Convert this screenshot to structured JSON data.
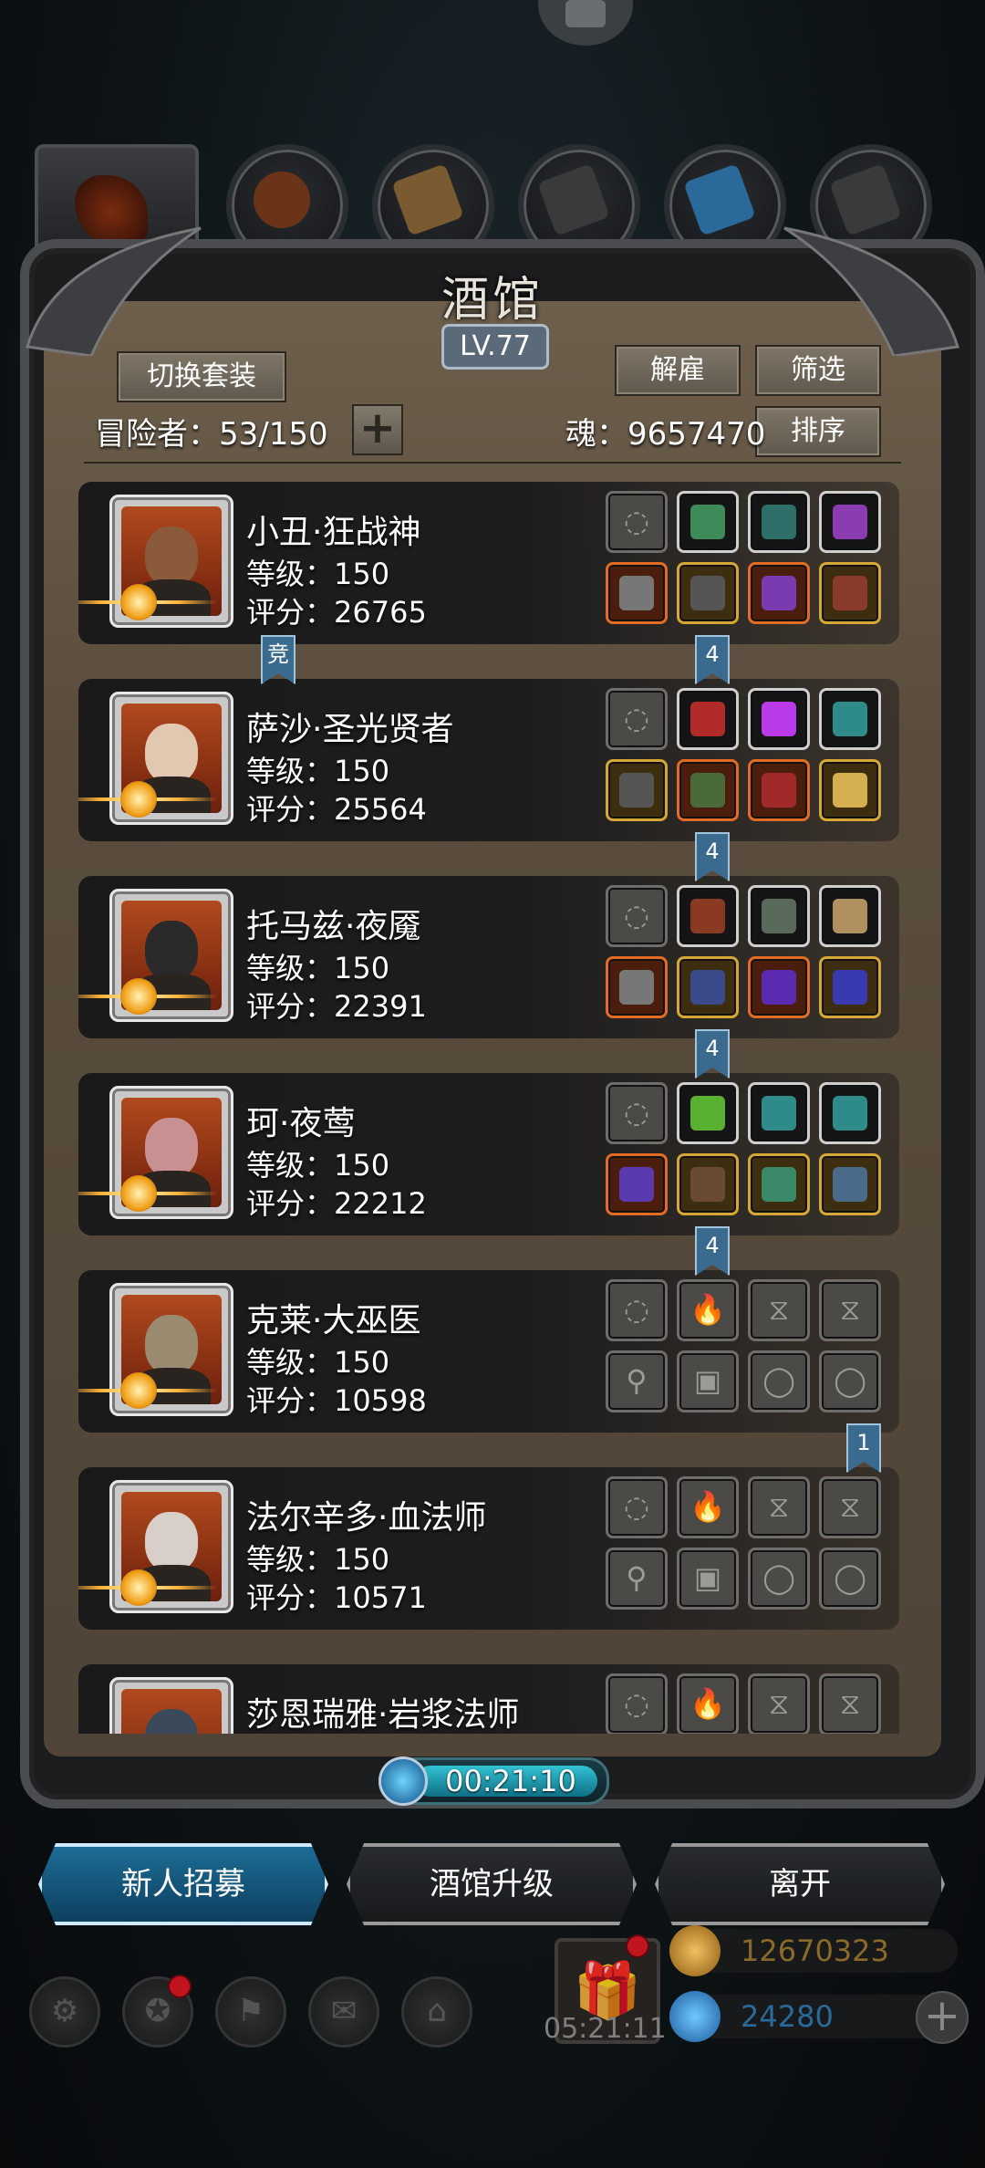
{
  "tavern": {
    "title": "酒馆",
    "level": "LV.77",
    "switch_outfit": "切换套装",
    "dismiss": "解雇",
    "filter": "筛选",
    "sort": "排序",
    "adventurers_label": "冒险者：53/150",
    "souls_label": "魂：9657470",
    "add": "+"
  },
  "category_tabs": [
    "all",
    "armor",
    "cloak",
    "boots",
    "crystal",
    "material"
  ],
  "heroes": [
    {
      "name": "小丑·狂战神",
      "level": "等级：150",
      "score": "评分：26765",
      "portrait_color": "#8a5a3a",
      "slots_top": [
        {
          "t": "empty",
          "i": "necklace-icon"
        },
        {
          "t": "white",
          "i": "emerald-icon",
          "c": "#3d8a5a"
        },
        {
          "t": "white",
          "i": "stone-icon",
          "c": "#2f6f6a"
        },
        {
          "t": "white",
          "i": "lantern-icon",
          "c": "#8a3cb0"
        }
      ],
      "slots_bottom": [
        {
          "t": "orange",
          "i": "axe-icon",
          "c": "#777"
        },
        {
          "t": "gold",
          "i": "armor-icon",
          "c": "#555"
        },
        {
          "t": "orange",
          "i": "helmet-icon",
          "c": "#7a3ab0"
        },
        {
          "t": "gold",
          "i": "bracer-icon",
          "c": "#8a3a2a"
        }
      ]
    },
    {
      "name": "萨沙·圣光贤者",
      "level": "等级：150",
      "score": "评分：25564",
      "portrait_color": "#e2c8b0",
      "slots_top": [
        {
          "t": "empty",
          "i": "necklace-icon"
        },
        {
          "t": "white",
          "i": "rose-icon",
          "c": "#b02a2a"
        },
        {
          "t": "white",
          "i": "amethyst-icon",
          "c": "#b83ae8"
        },
        {
          "t": "white",
          "i": "stone-icon",
          "c": "#2f8a8a"
        }
      ],
      "slots_bottom": [
        {
          "t": "gold",
          "i": "spear-icon",
          "c": "#555"
        },
        {
          "t": "orange",
          "i": "armor-icon",
          "c": "#4a6a3a"
        },
        {
          "t": "orange",
          "i": "helmet-icon",
          "c": "#a02a2a"
        },
        {
          "t": "gold",
          "i": "shield-icon",
          "c": "#d4b050"
        }
      ]
    },
    {
      "name": "托马兹·夜魇",
      "level": "等级：150",
      "score": "评分：22391",
      "portrait_color": "#2a2a2a",
      "slots_top": [
        {
          "t": "empty",
          "i": "necklace-icon"
        },
        {
          "t": "white",
          "i": "meat-icon",
          "c": "#8a3a20"
        },
        {
          "t": "white",
          "i": "rabbit-icon",
          "c": "#5a6a5a"
        },
        {
          "t": "white",
          "i": "book-icon",
          "c": "#b09060"
        }
      ],
      "slots_bottom": [
        {
          "t": "orange",
          "i": "spear-icon",
          "c": "#777"
        },
        {
          "t": "gold",
          "i": "armor-icon",
          "c": "#3a4a8a"
        },
        {
          "t": "orange",
          "i": "helmet-icon",
          "c": "#5a2ab0"
        },
        {
          "t": "gold",
          "i": "ring-icon",
          "c": "#3a3ab0"
        }
      ]
    },
    {
      "name": "珂·夜莺",
      "level": "等级：150",
      "score": "评分：22212",
      "portrait_color": "#c89090",
      "slots_top": [
        {
          "t": "empty",
          "i": "necklace-icon"
        },
        {
          "t": "white",
          "i": "potion-icon",
          "c": "#5ab030"
        },
        {
          "t": "white",
          "i": "stone-icon",
          "c": "#2f8a8a"
        },
        {
          "t": "white",
          "i": "stone-icon",
          "c": "#2f8a8a"
        }
      ],
      "slots_bottom": [
        {
          "t": "orange",
          "i": "dagger-icon",
          "c": "#5a3ab0"
        },
        {
          "t": "gold",
          "i": "armor-icon",
          "c": "#6a4a30"
        },
        {
          "t": "gold",
          "i": "bracer-icon",
          "c": "#3a8a6a"
        },
        {
          "t": "gold",
          "i": "amulet-icon",
          "c": "#4a6a8a"
        }
      ]
    },
    {
      "name": "克莱·大巫医",
      "level": "等级：150",
      "score": "评分：10598",
      "portrait_color": "#9a8a70",
      "slots_top": [
        {
          "t": "empty",
          "i": "necklace-icon"
        },
        {
          "t": "empty",
          "i": "flame-icon",
          "g": "🔥"
        },
        {
          "t": "empty",
          "i": "hourglass-icon",
          "g": "⧖"
        },
        {
          "t": "empty",
          "i": "hourglass-icon",
          "g": "⧖"
        }
      ],
      "slots_bottom": [
        {
          "t": "empty",
          "i": "staff-icon",
          "g": "⚲"
        },
        {
          "t": "empty",
          "i": "armor-icon",
          "g": "▣"
        },
        {
          "t": "empty",
          "i": "ring-icon",
          "g": "◯"
        },
        {
          "t": "empty",
          "i": "ring-icon",
          "g": "◯"
        }
      ]
    },
    {
      "name": "法尔辛多·血法师",
      "level": "等级：150",
      "score": "评分：10571",
      "portrait_color": "#d8cfc8",
      "slots_top": [
        {
          "t": "empty",
          "i": "necklace-icon"
        },
        {
          "t": "empty",
          "i": "flame-icon",
          "g": "🔥"
        },
        {
          "t": "empty",
          "i": "hourglass-icon",
          "g": "⧖"
        },
        {
          "t": "empty",
          "i": "hourglass-icon",
          "g": "⧖"
        }
      ],
      "slots_bottom": [
        {
          "t": "empty",
          "i": "staff-icon",
          "g": "⚲"
        },
        {
          "t": "empty",
          "i": "armor-icon",
          "g": "▣"
        },
        {
          "t": "empty",
          "i": "ring-icon",
          "g": "◯"
        },
        {
          "t": "empty",
          "i": "ring-icon",
          "g": "◯"
        }
      ]
    },
    {
      "name": "莎恩瑞雅·岩浆法师",
      "level": "",
      "score": "",
      "portrait_color": "#3a4a5a",
      "slots_top": [
        {
          "t": "empty",
          "i": "necklace-icon"
        },
        {
          "t": "empty",
          "i": "flame-icon",
          "g": "🔥"
        },
        {
          "t": "empty",
          "i": "hourglass-icon",
          "g": "⧖"
        },
        {
          "t": "empty",
          "i": "hourglass-icon",
          "g": "⧖"
        }
      ],
      "slots_bottom": []
    }
  ],
  "ribbons": [
    {
      "text": "竞",
      "row": 0,
      "pos": "left"
    },
    {
      "text": "4",
      "row": 0,
      "pos": "right"
    },
    {
      "text": "4",
      "row": 1,
      "pos": "right"
    },
    {
      "text": "4",
      "row": 2,
      "pos": "right"
    },
    {
      "text": "4",
      "row": 3,
      "pos": "right"
    },
    {
      "text": "1",
      "row": 4,
      "pos": "far-right"
    }
  ],
  "timer": "00:21:10",
  "buttons": {
    "recruit": "新人招募",
    "upgrade": "酒馆升级",
    "leave": "离开"
  },
  "tray": {
    "gift_timer": "05:21:11"
  },
  "resources": {
    "gold": "12670323",
    "gems": "24280",
    "add": "+"
  },
  "colors": {
    "gold_text": "#8a6a2a",
    "gem_text": "#2a6a9a"
  }
}
